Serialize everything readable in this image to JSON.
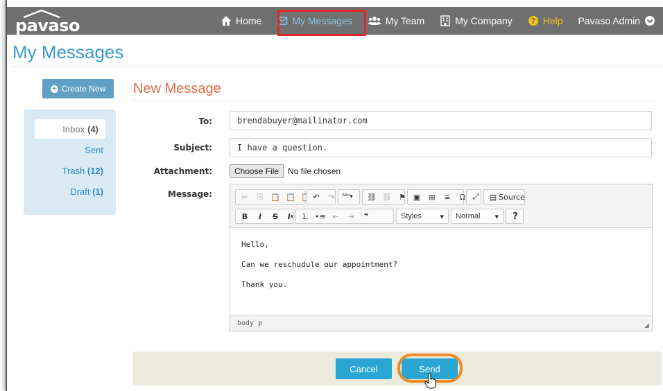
{
  "app": {
    "logo_text": "pavaso"
  },
  "nav": {
    "home": "Home",
    "messages": "My Messages",
    "team": "My Team",
    "company": "My Company",
    "help": "Help",
    "admin": "Pavaso Admin"
  },
  "page": {
    "title": "My Messages"
  },
  "sidebar": {
    "create_label": "Create New",
    "inbox_label": "Inbox",
    "inbox_count": "(4)",
    "sent_label": "Sent",
    "trash_label": "Trash",
    "trash_count": "(12)",
    "draft_label": "Draft",
    "draft_count": "(1)"
  },
  "form": {
    "title": "New Message",
    "to_label": "To:",
    "to_value": "brendabuyer@mailinator.com",
    "subject_label": "Subject:",
    "subject_value": "I have a question.",
    "attachment_label": "Attachment:",
    "choose_file": "Choose File",
    "no_file": "No file chosen",
    "message_label": "Message:"
  },
  "editor": {
    "source_label": "Source",
    "styles_label": "Styles",
    "format_label": "Normal",
    "body_lines": [
      "Hello,",
      "Can we reschudule our appointment?",
      "Thank you."
    ],
    "status_path": "body  p"
  },
  "actions": {
    "cancel": "Cancel",
    "send": "Send"
  },
  "colors": {
    "accent": "#2aa6d2",
    "title": "#3a9bd0",
    "form_title": "#e06d4a",
    "highlight": "#e0282c",
    "ring": "#f08a24"
  }
}
